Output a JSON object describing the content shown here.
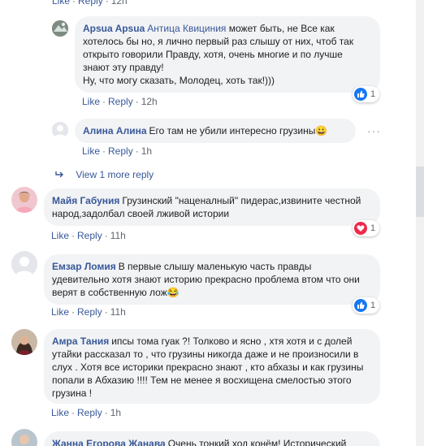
{
  "labels": {
    "like": "Like",
    "reply": "Reply",
    "sep": "·"
  },
  "top_actions": {
    "time": "12h"
  },
  "comments": [
    {
      "author": "Apsua Apsua",
      "mention": "Антица Квициния",
      "text": " может быть, не Все как хотелось бы но, я лично первый раз слышу от них, чтоб так открыто говорили Правду, хотя, очень многие и по лучше знают эту правду!\nНу, что могу сказать, Молодец, хоть так!)))",
      "time": "12h",
      "reaction_icon": "like-icon",
      "reaction_count": "1"
    },
    {
      "author": "Алина Алина",
      "text": "Его там не убили интересно грузины",
      "emoji": "😀",
      "time": "1h"
    },
    {
      "author": "Майя Габуния",
      "text": "Грузинский \"наценалный\" пидерас,извините честной народ,задолбал своей лживой истории",
      "time": "11h",
      "reaction_icon": "love-icon",
      "reaction_count": "1"
    },
    {
      "author": "Емзар Ломия",
      "text": "В первые слышу маленькую часть правды удевительно хотя знают историю прекрасно проблема втом что они верят в собственную лож",
      "emoji": "😂",
      "time": "11h",
      "reaction_icon": "like-icon",
      "reaction_count": "1"
    },
    {
      "author": "Амра Тания",
      "text": "ипсы тома гуак ?! Толково и ясно , хтя хотя и с долей утайки рассказал то , что грузины никогда даже и не произносили в слух . Хотя все историки прекрасно знают , кто абхазы и как грузины попали в Абхазию !!!! Тем не менее я восхищена смелостью этого грузина !",
      "time": "1h"
    },
    {
      "author": "Жанна Егорова Жанава",
      "text": "Очень тонкий ход конём! Исторический"
    }
  ],
  "view_more": "View 1 more reply",
  "colors": {
    "link": "#385898",
    "bubble": "#f2f3f5",
    "meta": "#606770",
    "like_blue": "#1877f2",
    "love_red": "#f0284a"
  }
}
